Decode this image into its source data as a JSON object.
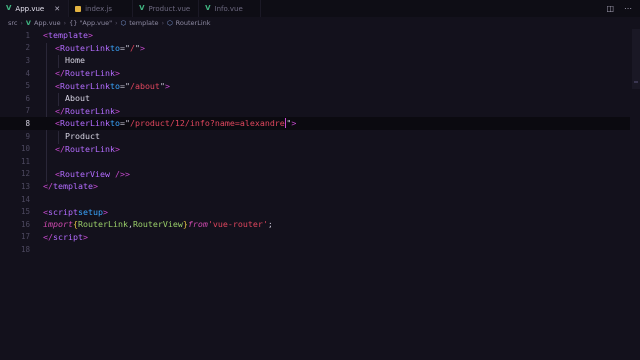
{
  "tabs": [
    {
      "label": "App.vue",
      "icon": "vue-icon",
      "active": true,
      "close": "✕"
    },
    {
      "label": "index.js",
      "icon": "js-icon",
      "active": false
    },
    {
      "label": "Product.vue",
      "icon": "vue-icon",
      "active": false
    },
    {
      "label": "Info.vue",
      "icon": "vue-icon",
      "active": false
    }
  ],
  "breadcrumb": {
    "folder": "src",
    "file": "App.vue",
    "object": "{} \"App.vue\"",
    "template": "template",
    "symbol": "RouterLink"
  },
  "editor": {
    "current_line": 8,
    "lines": [
      {
        "n": "1"
      },
      {
        "n": "2"
      },
      {
        "n": "3"
      },
      {
        "n": "4"
      },
      {
        "n": "5"
      },
      {
        "n": "6"
      },
      {
        "n": "7"
      },
      {
        "n": "8"
      },
      {
        "n": "9"
      },
      {
        "n": "10"
      },
      {
        "n": "11"
      },
      {
        "n": "12"
      },
      {
        "n": "13"
      },
      {
        "n": "14"
      },
      {
        "n": "15"
      },
      {
        "n": "16"
      },
      {
        "n": "17"
      },
      {
        "n": "18"
      }
    ],
    "tokens": {
      "lt": "<",
      "gt": ">",
      "lt_slash": "</",
      "self_close": " />",
      "template": "template",
      "router_link": "RouterLink",
      "router_view": "RouterView",
      "to": "to",
      "eq": "=",
      "quote": "\"",
      "href_home": "/",
      "href_about": "/about",
      "href_product": "/product/12/info?name=alexandre",
      "text_home": "Home",
      "text_about": "About",
      "text_product": "Product",
      "script": "script",
      "setup": "setup",
      "import": "import",
      "from": "from",
      "brace_open": "{",
      "brace_close": "}",
      "comma": ",",
      "router_link_ident": "RouterLink",
      "router_view_ident": "RouterView",
      "module": "'vue-router'",
      "semicolon": ";"
    }
  }
}
